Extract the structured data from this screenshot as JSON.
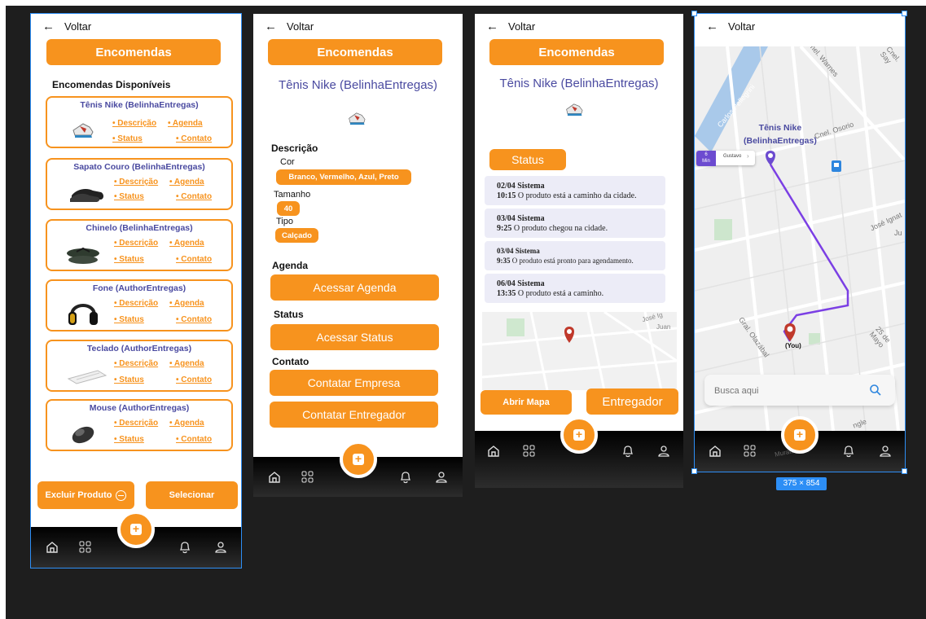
{
  "common": {
    "back_label": "Voltar",
    "title_button": "Encomendas"
  },
  "screen1": {
    "section_title": "Encomendas Disponíveis",
    "cards": [
      {
        "name": "Tênis Nike (BelinhaEntregas)",
        "image": "sneaker-image"
      },
      {
        "name": "Sapato Couro (BelinhaEntregas)",
        "image": "leather-shoe-image"
      },
      {
        "name": "Chinelo (BelinhaEntregas)",
        "image": "sandal-image"
      },
      {
        "name": "Fone (AuthorEntregas)",
        "image": "headphones-image"
      },
      {
        "name": "Teclado (AuthorEntregas)",
        "image": "keyboard-image"
      },
      {
        "name": "Mouse (AuthorEntregas)",
        "image": "mouse-image"
      }
    ],
    "links": {
      "descricao": "• Descrição",
      "agenda": "• Agenda",
      "status": "• Status",
      "contato": "• Contato"
    },
    "delete_button": "Excluir Produto",
    "select_button": "Selecionar"
  },
  "screen2": {
    "product_name": "Tênis Nike (BelinhaEntregas)",
    "descricao_heading": "Descrição",
    "cor_label": "Cor",
    "cor_value": "Branco, Vermelho, Azul, Preto",
    "tamanho_label": "Tamanho",
    "tamanho_value": "40",
    "tipo_label": "Tipo",
    "tipo_value": "Calçado",
    "agenda_heading": "Agenda",
    "agenda_button": "Acessar Agenda",
    "status_heading": "Status",
    "status_button": "Acessar Status",
    "contato_heading": "Contato",
    "contact_company": "Contatar Empresa",
    "contact_courier": "Contatar Entregador"
  },
  "screen3": {
    "product_name": "Tênis Nike (BelinhaEntregas)",
    "status_button": "Status",
    "events": [
      {
        "date": "02/04",
        "source": "Sistema",
        "time": "10:15",
        "text": "O produto está a caminho da cidade."
      },
      {
        "date": "03/04",
        "source": "Sistema",
        "time": "9:25",
        "text": "O produto chegou na cidade."
      },
      {
        "date": "03/04",
        "source": "Sistema",
        "time": "9:35",
        "text": "O produto está pronto para agendamento."
      },
      {
        "date": "06/04",
        "source": "Sistema",
        "time": "13:35",
        "text": "O produto está a caminho."
      }
    ],
    "map_streets": [
      "José Ig",
      "Juan"
    ],
    "open_map": "Abrir Mapa",
    "courier": "Entregador"
  },
  "screen4": {
    "product_line1": "Tênis Nike",
    "product_line2": "(BelinhaEntregas)",
    "eta_value": "6",
    "eta_unit": "Min",
    "driver_name": "Gustavo",
    "you_label": "(You)",
    "search_placeholder": "Busca aqui",
    "streets": [
      "Carlos Pellegrini",
      "Cnel. Warnes",
      "Cnel. Say",
      "Cnel. Osorio",
      "José Ignat",
      "Ju",
      "Gral. Olazábal",
      "25 de Mayo",
      "ngle",
      "Muratur"
    ]
  },
  "size_badge": "375 × 854",
  "colors": {
    "accent": "#f7931e",
    "purple_text": "#4a4aa0",
    "route": "#7b3fe4",
    "selection": "#2d8ef5"
  }
}
